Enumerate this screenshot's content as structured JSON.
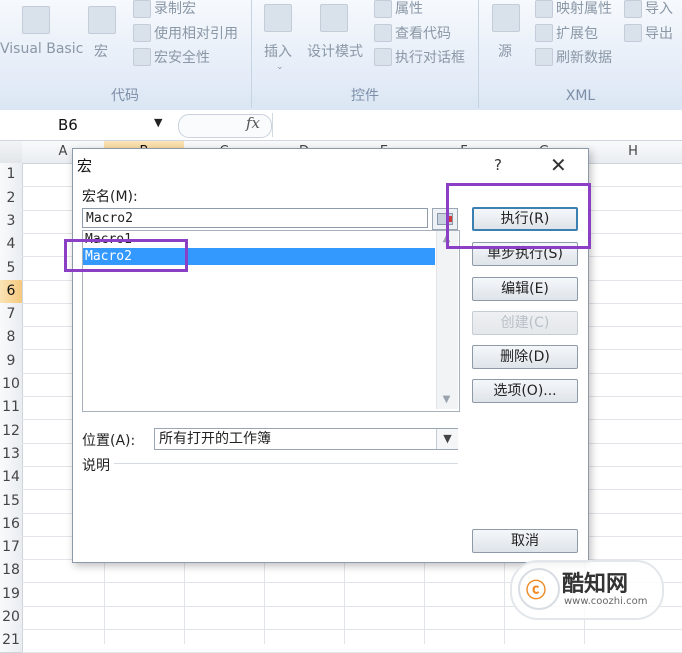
{
  "ribbon": {
    "groups": {
      "code": {
        "label": "代码",
        "items": {
          "visual_basic": "Visual Basic",
          "macros": "宏",
          "record_macro": "录制宏",
          "use_relative": "使用相对引用",
          "macro_security": "宏安全性"
        }
      },
      "controls": {
        "label": "控件",
        "items": {
          "insert": "插入",
          "design_mode": "设计模式",
          "properties": "属性",
          "view_code": "查看代码",
          "run_dialog": "执行对话框"
        }
      },
      "xml": {
        "label": "XML",
        "items": {
          "source": "源",
          "map_properties": "映射属性",
          "expansion_packs": "扩展包",
          "refresh_data": "刷新数据",
          "import": "导入",
          "export": "导出"
        }
      }
    }
  },
  "formula_bar": {
    "name_box": "B6",
    "fx": "fx"
  },
  "sheet": {
    "columns": [
      "A",
      "B",
      "C",
      "D",
      "E",
      "F",
      "G",
      "H"
    ],
    "rows": [
      "1",
      "2",
      "3",
      "4",
      "5",
      "6",
      "7",
      "8",
      "9",
      "10",
      "11",
      "12",
      "13",
      "14",
      "15",
      "16",
      "17",
      "18",
      "19",
      "20",
      "21"
    ]
  },
  "dialog": {
    "title": "宏",
    "help": "?",
    "close": "✕",
    "macro_name_label": "宏名(M):",
    "macro_name_value": "Macro2",
    "macros": [
      "Macro1",
      "Macro2"
    ],
    "location_label": "位置(A):",
    "location_value": "所有打开的工作簿",
    "description_label": "说明",
    "buttons": {
      "run": "执行(R)",
      "step_into": "单步执行(S)",
      "edit": "编辑(E)",
      "create": "创建(C)",
      "delete": "删除(D)",
      "options": "选项(O)...",
      "cancel": "取消"
    }
  },
  "watermark": {
    "title": "酷知网",
    "url": "www.coozhi.com"
  }
}
